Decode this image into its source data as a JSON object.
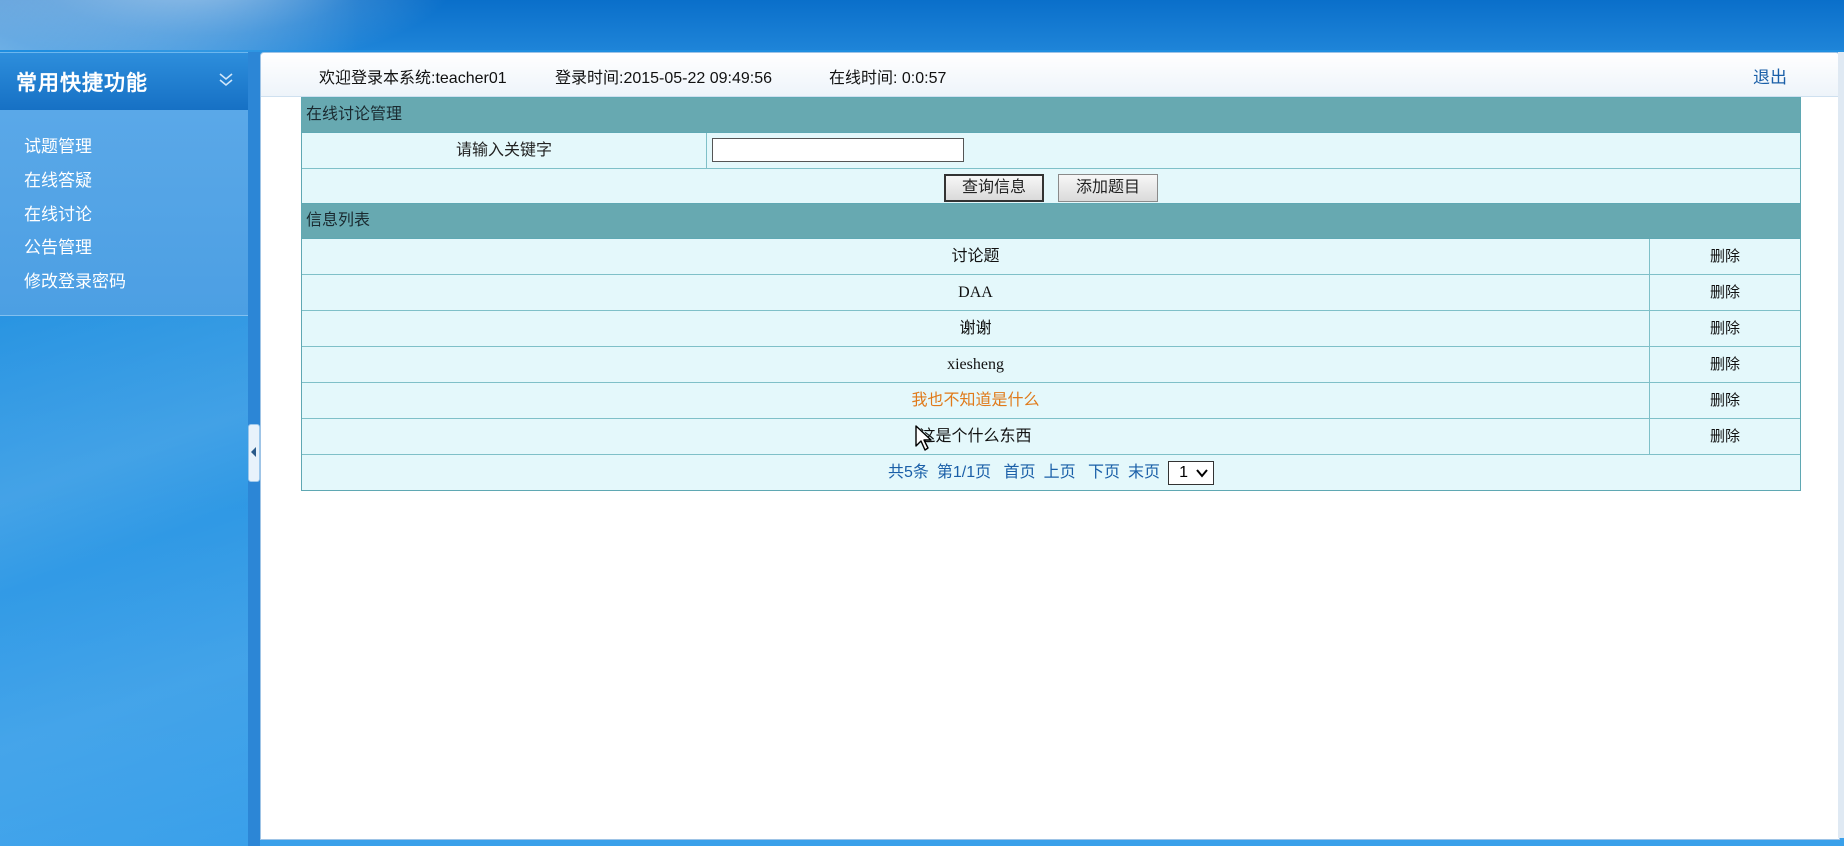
{
  "sidebar": {
    "title": "常用快捷功能",
    "items": [
      {
        "label": "试题管理"
      },
      {
        "label": "在线答疑"
      },
      {
        "label": "在线讨论"
      },
      {
        "label": "公告管理"
      },
      {
        "label": "修改登录密码"
      }
    ]
  },
  "header": {
    "welcome": "欢迎登录本系统:teacher01",
    "login_time": "登录时间:2015-05-22 09:49:56",
    "online_time": "在线时间: 0:0:57",
    "logout": "退出"
  },
  "search_section": {
    "title": "在线讨论管理",
    "keyword_label": "请输入关键字",
    "keyword_value": "",
    "query_button": "查询信息",
    "add_button": "添加题目"
  },
  "list_section": {
    "title": "信息列表",
    "rows": [
      {
        "title": "讨论题",
        "action": "删除"
      },
      {
        "title": "DAA",
        "action": "删除"
      },
      {
        "title": "谢谢",
        "action": "删除"
      },
      {
        "title": "xiesheng",
        "action": "删除"
      },
      {
        "title": "我也不知道是什么",
        "action": "删除"
      },
      {
        "title": "这是个什么东西",
        "action": "删除"
      }
    ]
  },
  "pager": {
    "total": "共5条",
    "page_info": "第1/1页",
    "first": "首页",
    "prev": "上页",
    "next": "下页",
    "last": "末页",
    "selected_page": "1"
  },
  "colors": {
    "section_header": "#67a9b1",
    "row_background": "#e4f8fb",
    "link_blue": "#1a5fa8",
    "highlight_orange": "#e07a1a"
  }
}
